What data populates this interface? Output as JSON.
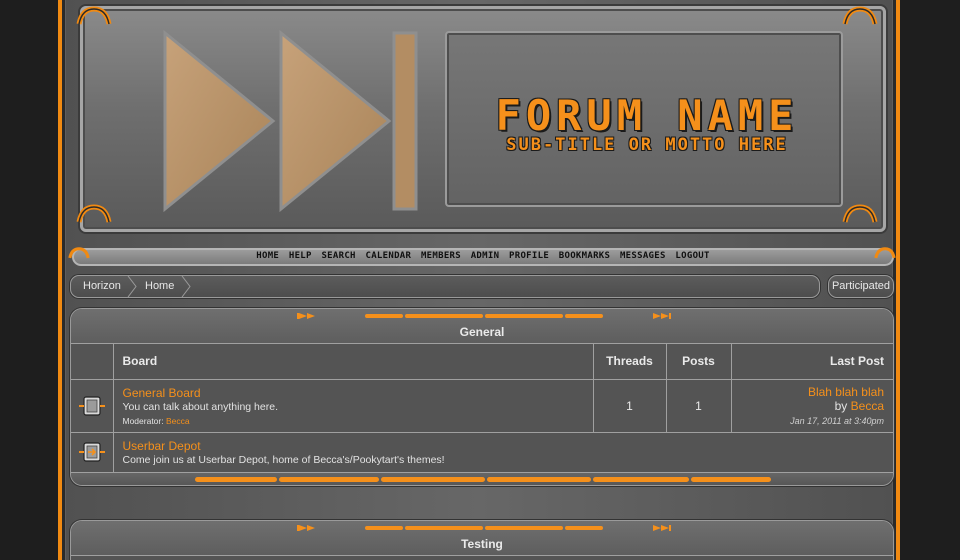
{
  "header": {
    "forum_name": "Forum Name",
    "subtitle": "Sub-title or motto here"
  },
  "nav": {
    "links": [
      "Home",
      "Help",
      "Search",
      "Calendar",
      "Members",
      "Admin",
      "Profile",
      "Bookmarks",
      "Messages",
      "Logout"
    ]
  },
  "breadcrumb": {
    "items": [
      "Horizon",
      "Home"
    ]
  },
  "participated_label": "Participated",
  "categories": [
    {
      "title": "General",
      "headers": {
        "board": "Board",
        "threads": "Threads",
        "posts": "Posts",
        "last_post": "Last Post"
      },
      "boards": [
        {
          "name": "General Board",
          "description": "You can talk about anything here.",
          "moderator_label": "Moderator:",
          "moderator": "Becca",
          "threads": "1",
          "posts": "1",
          "last_post_title": "Blah blah blah",
          "last_post_by": "by",
          "last_post_user": "Becca",
          "last_post_date": "Jan 17, 2011 at 3:40pm",
          "icon": "board-icon"
        },
        {
          "name": "Userbar Depot",
          "description": "Come join us at Userbar Depot, home of Becca's/Pookytart's themes!",
          "icon": "link-board-icon"
        }
      ]
    },
    {
      "title": "Testing"
    }
  ],
  "colors": {
    "accent": "#f5901b",
    "background": "#1e1e1e",
    "panel": "#545454"
  }
}
